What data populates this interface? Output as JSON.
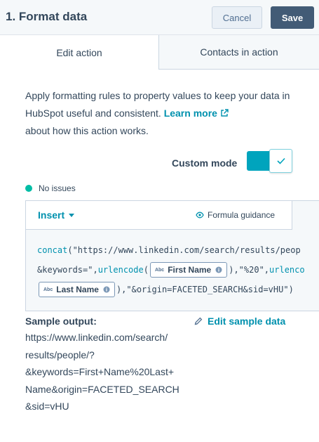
{
  "header": {
    "title": "1. Format data",
    "cancel_label": "Cancel",
    "save_label": "Save"
  },
  "tabs": [
    {
      "label": "Edit action",
      "active": true
    },
    {
      "label": "Contacts in action",
      "active": false
    }
  ],
  "description": {
    "text_before": "Apply formatting rules to property values to keep your data in HubSpot useful and consistent. ",
    "link_label": "Learn more",
    "text_after": "about how this action works."
  },
  "custom_mode": {
    "label": "Custom mode",
    "enabled": true
  },
  "status": {
    "text": "No issues",
    "color": "#00bda5"
  },
  "editor": {
    "insert_label": "Insert",
    "guidance_label": "Formula guidance",
    "code": {
      "line1_fn": "concat",
      "line1_text": "(\"https://www.linkedin.com/search/results/peop",
      "line2_text_a": "&keywords=\",",
      "line2_fn": "urlencode",
      "line2_paren": "(",
      "chip_first_name": "First Name",
      "line2_text_b": "),\"%20\",",
      "line2_fn2": "urlenco",
      "chip_last_name": "Last Name",
      "line3_text": "),\"&origin=FACETED_SEARCH&sid=vHU\")",
      "chip_type_label": "Abc"
    }
  },
  "sample": {
    "label": "Sample output:",
    "edit_label": "Edit sample data",
    "lines": [
      "https://www.linkedin.com/search/",
      "results/people/?",
      "&keywords=First+Name%20Last+",
      "Name&origin=FACETED_SEARCH",
      "&sid=vHU"
    ]
  },
  "colors": {
    "accent": "#0091ae",
    "toggle": "#00a4bd",
    "primary_button": "#425b76",
    "text": "#33475b"
  }
}
